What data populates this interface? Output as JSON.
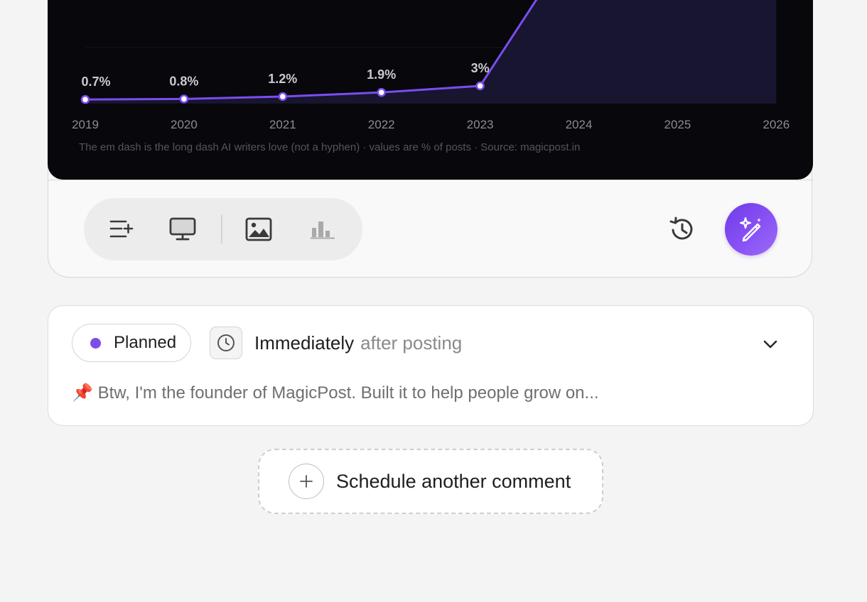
{
  "chart_data": {
    "type": "line",
    "x": [
      "2019",
      "2020",
      "2021",
      "2022",
      "2023",
      "2024",
      "2025",
      "2026"
    ],
    "series": [
      {
        "values": [
          0.7,
          0.8,
          1.2,
          1.9,
          3,
          null,
          null,
          null
        ],
        "labels": [
          "0.7%",
          "0.8%",
          "1.2%",
          "1.9%",
          "3%"
        ]
      }
    ],
    "caption": "The em dash is the long dash AI writers love (not a hyphen) · values are % of posts · Source: magicpost.in",
    "colors": {
      "line": "#7a4df0",
      "area": "#191733",
      "background": "#07070c"
    }
  },
  "toolbar": {
    "tools": [
      "list-add-icon",
      "monitor-icon",
      "image-icon",
      "bar-chart-icon"
    ],
    "history_icon": "history-icon",
    "ai_icon": "magic-pencil-icon",
    "accent": "#7c4dea"
  },
  "comment": {
    "status": "Planned",
    "status_color": "#7c4dea",
    "timing_strong": "Immediately",
    "timing_weak": "after posting",
    "preview_emoji": "📌",
    "preview_text": "Btw, I'm the founder of MagicPost. Built it to help people grow on..."
  },
  "schedule": {
    "label": "Schedule another comment"
  }
}
